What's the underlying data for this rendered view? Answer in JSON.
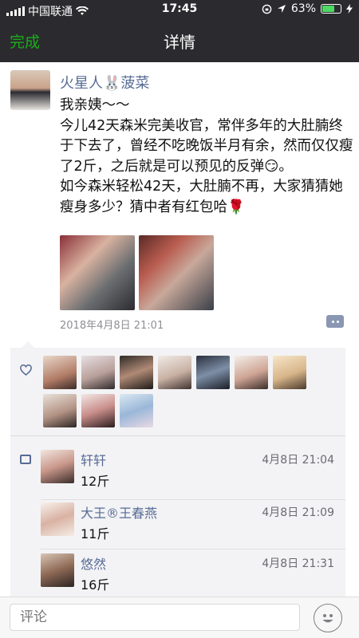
{
  "status_bar": {
    "carrier": "中国联通",
    "time": "17:45",
    "battery": "63%"
  },
  "nav": {
    "done_label": "完成",
    "title": "详情"
  },
  "post": {
    "author": "火星人🐰菠菜",
    "text": "我亲姨～～\n今儿42天森米完美收官，常伴多年的大肚腩终于下去了，曾经不吃晚饭半月有余，然而仅仅瘦了2斤，之后就是可以预见的反弹😏。\n如今森米轻松42天，大肚腩不再，大家猜猜她瘦身多少？猜中者有红包哈🌹",
    "timestamp": "2018年4月8日  21:01"
  },
  "comments": [
    {
      "name": "轩轩",
      "time": "4月8日 21:04",
      "text": "12斤"
    },
    {
      "name": "大王®王春燕",
      "time": "4月8日 21:09",
      "text": "11斤"
    },
    {
      "name": "悠然",
      "time": "4月8日 21:31",
      "text": "16斤"
    }
  ],
  "bottom": {
    "comment_placeholder": "评论"
  },
  "colors": {
    "nav_bg": "#2b2b2f",
    "accent_green": "#1aad19",
    "link_blue": "#576b95"
  },
  "icons": {
    "like": "heart-icon",
    "comment": "comment-icon",
    "emoji": "smiley-icon",
    "more": "more-icon"
  }
}
